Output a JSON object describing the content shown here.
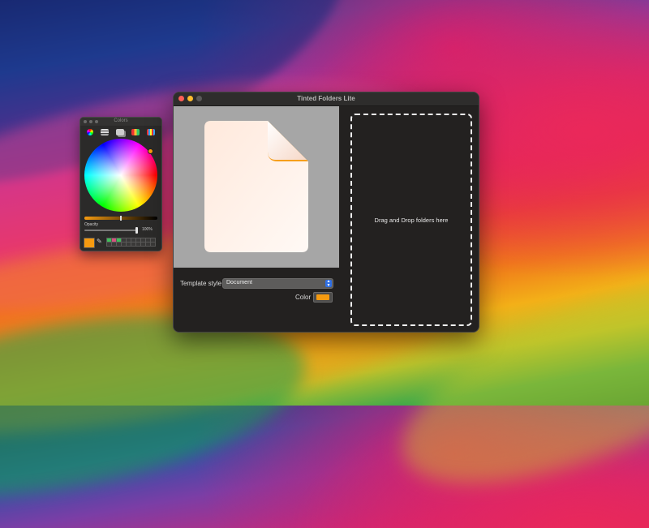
{
  "colors": {
    "selected": "#f59a10"
  },
  "colors_panel": {
    "title": "Colors",
    "modes": [
      "color-wheel-icon",
      "color-sliders-icon",
      "color-palettes-icon",
      "image-palettes-icon",
      "pencils-icon"
    ],
    "opacity_label": "Opacity",
    "opacity_value": "100%",
    "opacity_level": 1.0
  },
  "main_window": {
    "title": "Tinted Folders Lite",
    "template_style_label": "Template style",
    "template_style_value": "Document",
    "color_label": "Color",
    "drop_zone_text": "Drag and Drop folders here"
  }
}
